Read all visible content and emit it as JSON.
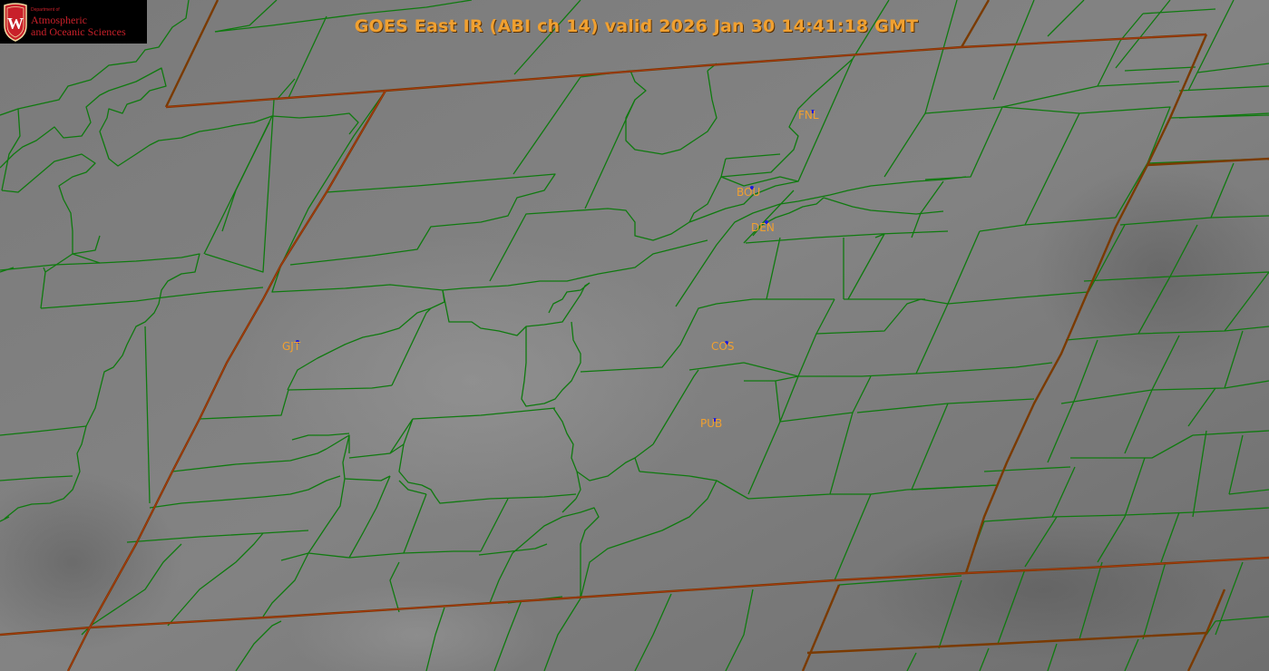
{
  "title": "GOES East IR (ABI ch 14) valid 2026 Jan 30 14:41:18 GMT",
  "logo": {
    "department": "Department of",
    "line1": "Atmospheric",
    "line2": "and Oceanic Sciences",
    "crest_letter": "W",
    "color": "#c8202a"
  },
  "colors": {
    "state_border": "#7a3a00",
    "county_border": "#0f7a0f",
    "station_label": "#f0a030",
    "station_marker": "#1a1ae0"
  },
  "stations": [
    {
      "id": "FNL",
      "label": "FNL"
    },
    {
      "id": "BOU",
      "label": "BOU"
    },
    {
      "id": "DEN",
      "label": "DEN"
    },
    {
      "id": "GJT",
      "label": "GJT"
    },
    {
      "id": "COS",
      "label": "COS"
    },
    {
      "id": "PUB",
      "label": "PUB"
    }
  ]
}
